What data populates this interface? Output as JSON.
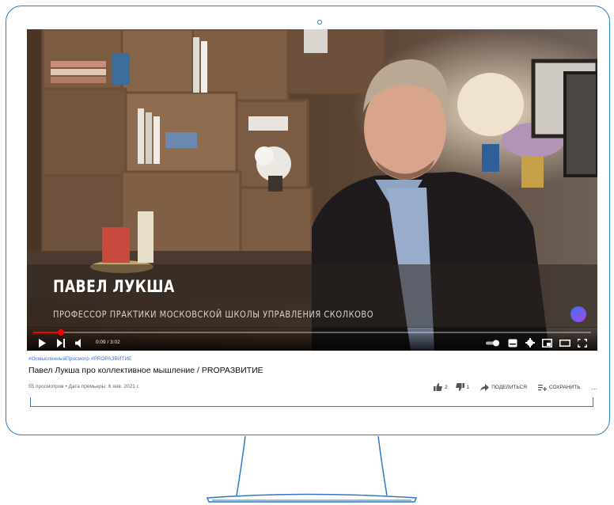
{
  "video": {
    "name_caption": "ПАВЕЛ ЛУКША",
    "title_caption": "ПРОФЕССОР ПРАКТИКИ МОСКОВСКОЙ ШКОЛЫ УПРАВЛЕНИЯ СКОЛКОВО",
    "time": "0:09 / 3:02",
    "progress_fraction": 0.05
  },
  "info": {
    "hashtags": "#ОсмысленныйПросмотр #PROРАЗВИТИЕ",
    "title": "Павел Лукша про коллективное мышление / PROРАЗВИТИЕ",
    "meta": "55 просмотров • Дата премьеры: 6 янв. 2021 г."
  },
  "actions": {
    "likes": "2",
    "dislikes": "1",
    "share_label": "ПОДЕЛИТЬСЯ",
    "save_label": "СОХРАНИТЬ",
    "more": "..."
  },
  "colors": {
    "monitor_outline": "#2c79c8",
    "progress": "#ff0000",
    "hashtag": "#3a6fd0"
  }
}
